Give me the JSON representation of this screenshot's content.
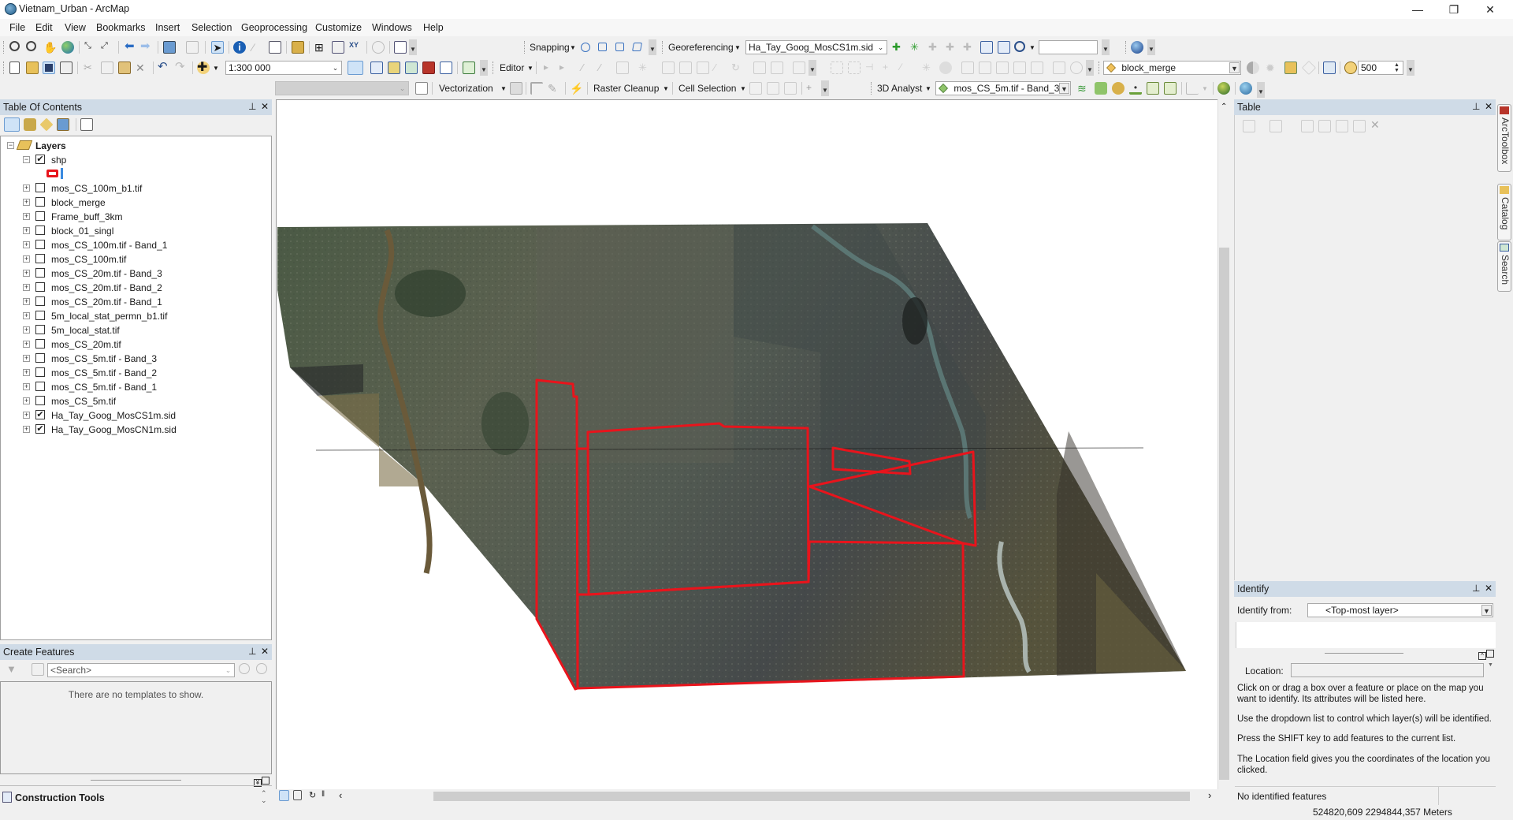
{
  "window": {
    "title": "Vietnam_Urban - ArcMap",
    "controls": {
      "minimize": "—",
      "restore": "❐",
      "close": "✕"
    }
  },
  "menubar": [
    "File",
    "Edit",
    "View",
    "Bookmarks",
    "Insert",
    "Selection",
    "Geoprocessing",
    "Customize",
    "Windows",
    "Help"
  ],
  "toolbars": {
    "scale_value": "1:300 000",
    "snapping_label": "Snapping",
    "georeferencing_label": "Georeferencing",
    "georef_layer": "Ha_Tay_Goog_MosCS1m.sid",
    "georef_input": "",
    "editor_label": "Editor",
    "target_layer": "block_merge",
    "time_value": "500",
    "vectorization_label": "Vectorization",
    "vectorization_layer": "",
    "raster_cleanup_label": "Raster Cleanup",
    "cell_selection_label": "Cell Selection",
    "analyst3d_label": "3D Analyst",
    "analyst3d_layer": "mos_CS_5m.tif - Band_3"
  },
  "toc": {
    "title": "Table Of Contents",
    "root": "Layers",
    "group": {
      "name": "shp",
      "checked": true
    },
    "layers": [
      {
        "name": "mos_CS_100m_b1.tif",
        "checked": false
      },
      {
        "name": "block_merge",
        "checked": false
      },
      {
        "name": "Frame_buff_3km",
        "checked": false
      },
      {
        "name": "block_01_singl",
        "checked": false
      },
      {
        "name": "mos_CS_100m.tif - Band_1",
        "checked": false
      },
      {
        "name": "mos_CS_100m.tif",
        "checked": false
      },
      {
        "name": "mos_CS_20m.tif - Band_3",
        "checked": false
      },
      {
        "name": "mos_CS_20m.tif - Band_2",
        "checked": false
      },
      {
        "name": "mos_CS_20m.tif - Band_1",
        "checked": false
      },
      {
        "name": "5m_local_stat_permn_b1.tif",
        "checked": false
      },
      {
        "name": "5m_local_stat.tif",
        "checked": false
      },
      {
        "name": "mos_CS_20m.tif",
        "checked": false
      },
      {
        "name": "mos_CS_5m.tif - Band_3",
        "checked": false
      },
      {
        "name": "mos_CS_5m.tif - Band_2",
        "checked": false
      },
      {
        "name": "mos_CS_5m.tif - Band_1",
        "checked": false
      },
      {
        "name": "mos_CS_5m.tif",
        "checked": false
      },
      {
        "name": "Ha_Tay_Goog_MosCS1m.sid",
        "checked": true
      },
      {
        "name": "Ha_Tay_Goog_MosCN1m.sid",
        "checked": true
      }
    ],
    "symbol_color": "#e8141c"
  },
  "create_features": {
    "title": "Create Features",
    "search_placeholder": "<Search>",
    "empty_message": "There are no templates to show.",
    "construction_tools": "Construction Tools"
  },
  "table_panel": {
    "title": "Table"
  },
  "identify": {
    "title": "Identify",
    "from_label": "Identify from:",
    "from_value": "<Top-most layer>",
    "location_label": "Location:",
    "location_value": "",
    "help": [
      "Click on or drag a box over a feature or place on the map you want to identify. Its attributes will be listed here.",
      "Use the dropdown list to control which layer(s) will be identified.",
      "Press the SHIFT key to add features to the current list.",
      "The Location field gives you the coordinates of the location you clicked."
    ],
    "status": "No identified features"
  },
  "side_tabs": [
    "ArcToolbox",
    "Catalog",
    "Search"
  ],
  "statusbar": {
    "coordinates": "524820,609  2294844,357 Meters"
  },
  "map": {
    "outline_color": "#e8141c"
  }
}
